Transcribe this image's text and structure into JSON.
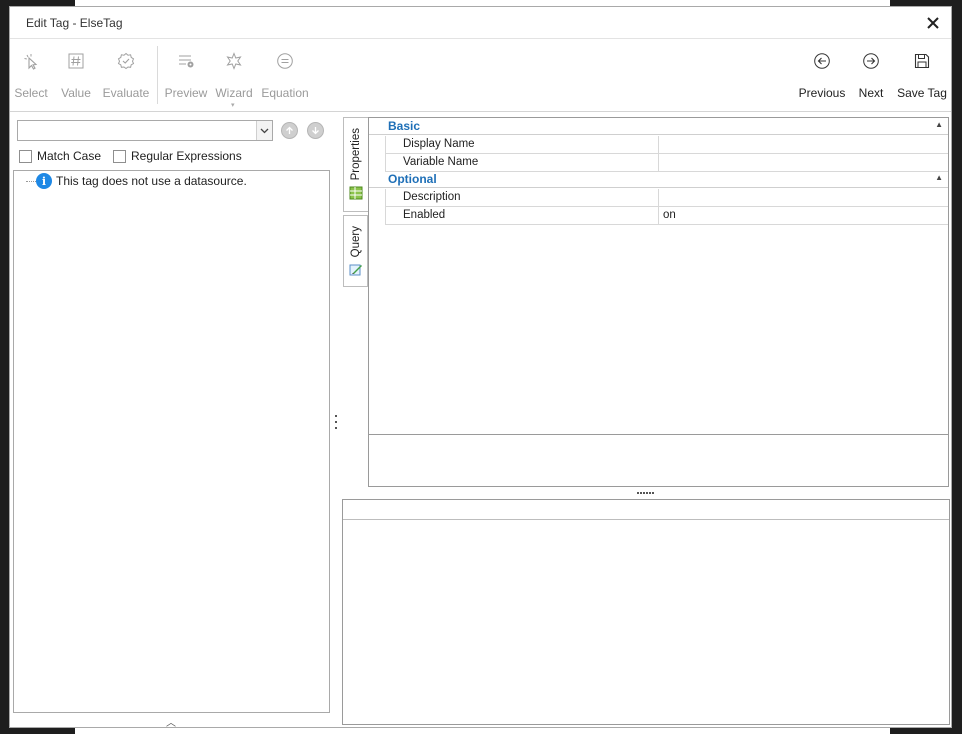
{
  "window": {
    "title": "Edit Tag - ElseTag"
  },
  "toolbar": {
    "select_label": "Select",
    "value_label": "Value",
    "evaluate_label": "Evaluate",
    "preview_label": "Preview",
    "wizard_label": "Wizard",
    "equation_label": "Equation",
    "previous_label": "Previous",
    "next_label": "Next",
    "save_label": "Save Tag"
  },
  "search": {
    "value": "",
    "match_case_label": "Match Case",
    "regex_label": "Regular Expressions"
  },
  "tree": {
    "message": "This tag does not use a datasource."
  },
  "tabs": {
    "properties_label": "Properties",
    "query_label": "Query"
  },
  "properties": {
    "basic_label": "Basic",
    "optional_label": "Optional",
    "display_name_label": "Display Name",
    "display_name_value": "",
    "variable_name_label": "Variable Name",
    "variable_name_value": "",
    "description_label": "Description",
    "description_value": "",
    "enabled_label": "Enabled",
    "enabled_value": "on"
  },
  "colors": {
    "category_text": "#1e6fb7",
    "info_icon": "#1e88e5",
    "disabled_text": "#9a9a9a"
  },
  "icons": [
    "select-cursor-icon",
    "hash-icon",
    "evaluate-badge-icon",
    "preview-list-icon",
    "wizard-star-icon",
    "equation-icon",
    "previous-arrow-icon",
    "next-arrow-icon",
    "save-disk-icon",
    "close-icon",
    "info-icon"
  ]
}
